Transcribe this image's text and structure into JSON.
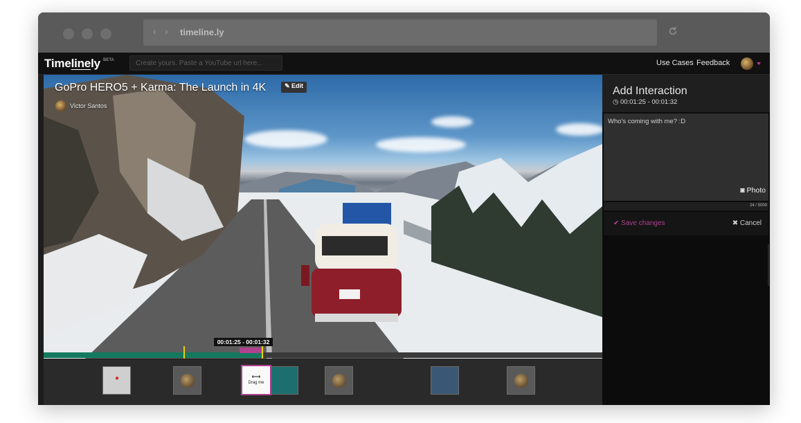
{
  "browser": {
    "url": "timeline.ly",
    "back_glyph": "‹",
    "forward_glyph": "›"
  },
  "app": {
    "logo_pre": "Time",
    "logo_mid": "line",
    "logo_post": "ly",
    "beta": "BETA",
    "search_placeholder": "Create yours. Paste a YouTube url here...",
    "nav": [
      "Use Cases",
      "Feedback"
    ]
  },
  "video": {
    "title": "GoPro HERO5 + Karma: The Launch in 4K",
    "edit_label": "Edit",
    "author": "Victor Santos",
    "range_label": "00:01:25 - 00:01:32"
  },
  "thumbs": {
    "drag_label": "Drag me"
  },
  "panel": {
    "title": "Add Interaction",
    "time": "00:01:25 - 00:01:32",
    "text": "Who's coming with me? :D",
    "photo_label": "Photo",
    "counter": "24 / 5000",
    "save_label": "Save changes",
    "cancel_label": "Cancel"
  },
  "colors": {
    "accent": "#b0418f",
    "progress": "#13795f",
    "marker": "#e8d200"
  }
}
